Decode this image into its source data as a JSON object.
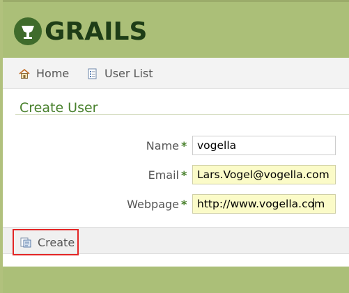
{
  "header": {
    "logo_text": "GRAILS",
    "colors": {
      "bar": "#abbf78",
      "logo": "#1e3d17"
    }
  },
  "nav": {
    "home_label": "Home",
    "home_icon": "house-icon",
    "user_list_label": "User List",
    "user_list_icon": "list-document-icon"
  },
  "page": {
    "title": "Create User"
  },
  "form": {
    "name": {
      "label": "Name",
      "required": "*",
      "value": "vogella"
    },
    "email": {
      "label": "Email",
      "required": "*",
      "value": "Lars.Vogel@vogella.com"
    },
    "webpage": {
      "label": "Webpage",
      "required": "*",
      "value": "http://www.vogella.com"
    }
  },
  "actions": {
    "create_label": "Create",
    "create_icon": "create-document-icon",
    "highlight_color": "#e32525"
  }
}
